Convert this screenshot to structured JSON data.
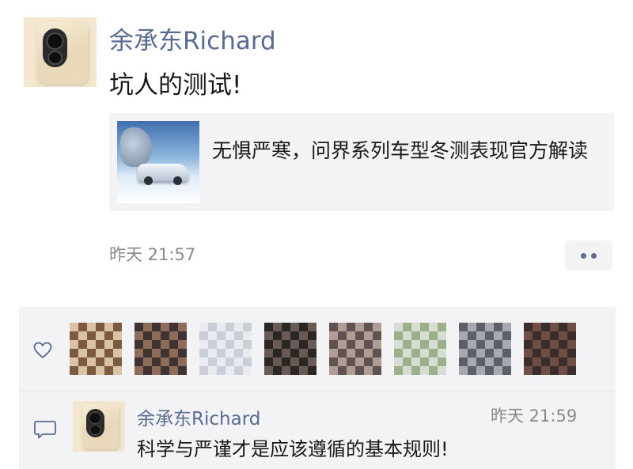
{
  "post": {
    "username": "余承东Richard",
    "text": "坑人的测试!",
    "link": {
      "title": "无惧严寒，问界系列车型冬测表现官方解读"
    },
    "time": "昨天 21:57"
  },
  "likes": {
    "avatars": [
      {
        "name": "liker-avatar-1",
        "color1": "#7c5a3d",
        "color2": "#d9c3a4"
      },
      {
        "name": "liker-avatar-2",
        "color1": "#8f6b5a",
        "color2": "#3e3232"
      },
      {
        "name": "liker-avatar-3",
        "color1": "#c9ced8",
        "color2": "#e9ebef"
      },
      {
        "name": "liker-avatar-4",
        "color1": "#6a5a55",
        "color2": "#2a2624"
      },
      {
        "name": "liker-avatar-5",
        "color1": "#b09c92",
        "color2": "#5f5352"
      },
      {
        "name": "liker-avatar-6",
        "color1": "#9ab08a",
        "color2": "#d8ddd3"
      },
      {
        "name": "liker-avatar-7",
        "color1": "#a7a9b2",
        "color2": "#5c5f66"
      },
      {
        "name": "liker-avatar-8",
        "color1": "#6f4f45",
        "color2": "#3b2d2b"
      }
    ]
  },
  "comment": {
    "username": "余承东Richard",
    "time": "昨天 21:59",
    "text": "科学与严谨才是应该遵循的基本规则!"
  },
  "colors": {
    "link_blue": "#576b95",
    "panel_bg": "#f3f3f5",
    "time_gray": "#8a8a8a"
  }
}
